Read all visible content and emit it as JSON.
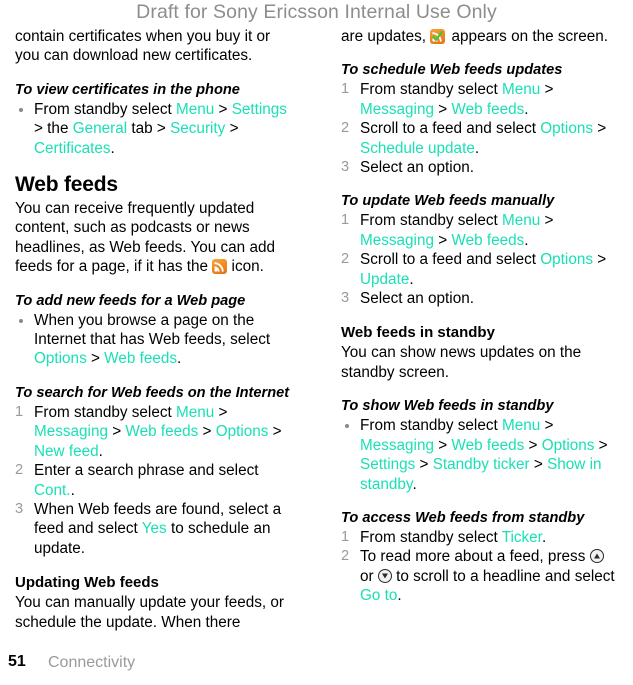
{
  "watermark": "Draft for Sony Ericsson Internal Use Only",
  "colors": {
    "accent_link": "#1ae0b4",
    "watermark": "#8d8d8d",
    "rss_orange": "#ef8620",
    "check_green": "#3ec73e",
    "list_marker": "#9a9a9a",
    "body_text": "#000000"
  },
  "footer": {
    "page_number": "51",
    "section": "Connectivity"
  },
  "left_column": {
    "continued_paragraph": {
      "line1": "contain certificates when you buy it or",
      "line2": "you can download new certificates."
    },
    "task_view_certificates": {
      "heading": "To view certificates in the phone",
      "bullet": {
        "pre": "From standby select ",
        "menu": "Menu",
        "sep1": " > ",
        "settings": "Settings",
        "mid1": " > the ",
        "general": "General",
        "mid2": " tab > ",
        "security": "Security",
        "sep2": " > ",
        "certificates": "Certificates",
        "end": "."
      }
    },
    "chapter": {
      "title": "Web feeds",
      "intro_pre": "You can receive frequently updated content, such as podcasts or news headlines, as Web feeds. You can add feeds for a page, if it has the ",
      "intro_icon": "rss-icon",
      "intro_post": " icon."
    },
    "task_add_new_feeds": {
      "heading": "To add new feeds for a Web page",
      "bullet": {
        "pre": "When you browse a page on the Internet that has Web feeds, select ",
        "options": "Options",
        "sep": " > ",
        "webfeeds": "Web feeds",
        "end": "."
      }
    },
    "task_search_feeds": {
      "heading": "To search for Web feeds on the Internet",
      "steps": [
        {
          "num": "1",
          "pre": "From standby select ",
          "menu": "Menu",
          "sep1": " > ",
          "messaging": "Messaging",
          "sep2": " > ",
          "webfeeds": "Web feeds",
          "sep3": " > ",
          "options": "Options",
          "sep4": " > ",
          "newfeed": "New feed",
          "end": "."
        },
        {
          "num": "2",
          "pre": "Enter a search phrase and select ",
          "cont": "Cont.",
          "end": "."
        },
        {
          "num": "3",
          "pre": "When Web feeds are found, select a feed and select ",
          "yes": "Yes",
          "post": " to schedule an update."
        }
      ]
    },
    "subsection_updating": {
      "heading": "Updating Web feeds",
      "body": "You can manually update your feeds, or schedule the update. When there"
    }
  },
  "right_column": {
    "continued_paragraph": {
      "pre": "are updates, ",
      "icon": "rss-updated-icon",
      "post": " appears on the screen."
    },
    "task_schedule_updates": {
      "heading": "To schedule Web feeds updates",
      "steps": [
        {
          "num": "1",
          "pre": "From standby select ",
          "menu": "Menu",
          "sep1": " > ",
          "messaging": "Messaging",
          "sep2": " > ",
          "webfeeds": "Web feeds",
          "end": "."
        },
        {
          "num": "2",
          "pre": "Scroll to a feed and select ",
          "options": "Options",
          "sep": " > ",
          "schedule": "Schedule update",
          "end": "."
        },
        {
          "num": "3",
          "pre": "Select an option."
        }
      ]
    },
    "task_update_manually": {
      "heading": "To update Web feeds manually",
      "steps": [
        {
          "num": "1",
          "pre": "From standby select ",
          "menu": "Menu",
          "sep1": " > ",
          "messaging": "Messaging",
          "sep2": " > ",
          "webfeeds": "Web feeds",
          "end": "."
        },
        {
          "num": "2",
          "pre": "Scroll to a feed and select ",
          "options": "Options",
          "sep": " > ",
          "update": "Update",
          "end": "."
        },
        {
          "num": "3",
          "pre": "Select an option."
        }
      ]
    },
    "subsection_standby": {
      "heading": "Web feeds in standby",
      "body": "You can show news updates on the standby screen."
    },
    "task_show_standby": {
      "heading": "To show Web feeds in standby",
      "bullet": {
        "pre": "From standby select ",
        "menu": "Menu",
        "sep1": " > ",
        "messaging": "Messaging",
        "sep2": " > ",
        "webfeeds": "Web feeds",
        "sep3": " > ",
        "options": "Options",
        "sep4": " > ",
        "settings": "Settings",
        "sep5": " > ",
        "ticker": "Standby ticker",
        "sep6": " > ",
        "showin": "Show in standby",
        "end": "."
      }
    },
    "task_access_standby": {
      "heading": "To access Web feeds from standby",
      "steps": [
        {
          "num": "1",
          "pre": "From standby select ",
          "ticker": "Ticker",
          "end": "."
        },
        {
          "num": "2",
          "pre": "To read more about a feed, press ",
          "key_up": "nav-up-icon",
          "mid": " or ",
          "key_down": "nav-down-icon",
          "post": " to scroll to a headline and select ",
          "goto": "Go to",
          "end": "."
        }
      ]
    }
  }
}
